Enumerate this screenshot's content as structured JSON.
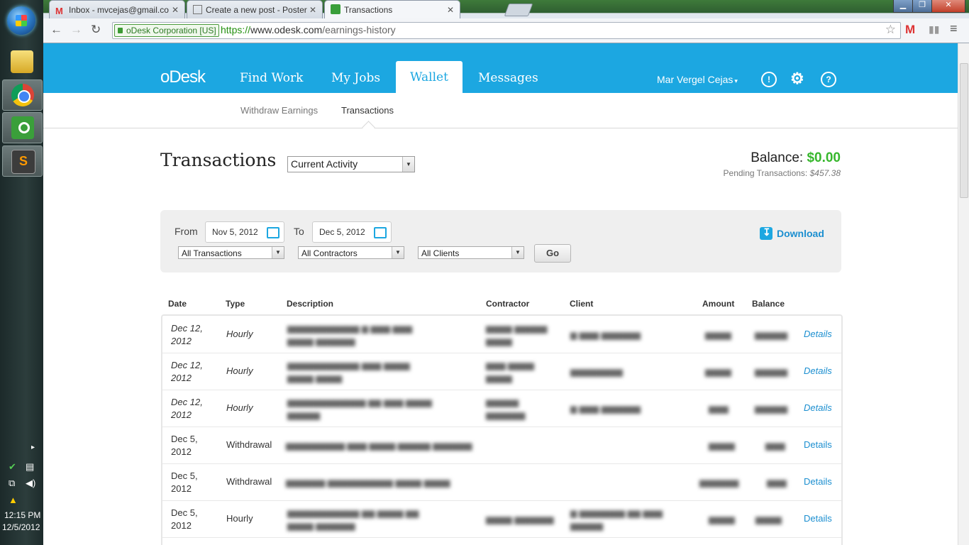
{
  "browser": {
    "tabs": [
      {
        "title": "Inbox - mvcejas@gmail.co",
        "active": false
      },
      {
        "title": "Create a new post - Poster",
        "active": false
      },
      {
        "title": "Transactions",
        "active": true
      }
    ],
    "ev_label": "oDesk Corporation [US]",
    "url_proto": "https://",
    "url_host": "www.odesk.com",
    "url_path": "/earnings-history"
  },
  "taskbar": {
    "time": "12:15 PM",
    "date": "12/5/2012"
  },
  "header": {
    "logo": "oDesk",
    "nav": [
      "Find Work",
      "My Jobs",
      "Wallet",
      "Messages"
    ],
    "active_nav": "Wallet",
    "user_name": "Mar Vergel Cejas"
  },
  "subnav": {
    "items": [
      "Withdraw Earnings",
      "Transactions"
    ],
    "active": "Transactions"
  },
  "page": {
    "title": "Transactions",
    "activity_select": "Current Activity",
    "balance_label": "Balance:",
    "balance_value": "$0.00",
    "pending_label": "Pending Transactions:",
    "pending_value": "$457.38"
  },
  "filters": {
    "from_label": "From",
    "from_date": "Nov 5, 2012",
    "to_label": "To",
    "to_date": "Dec 5, 2012",
    "type_select": "All Transactions",
    "contractor_select": "All Contractors",
    "client_select": "All Clients",
    "go_label": "Go",
    "download_label": "Download"
  },
  "table": {
    "headers": [
      "Date",
      "Type",
      "Description",
      "Contractor",
      "Client",
      "Amount",
      "Balance"
    ],
    "details_label": "Details",
    "rows": [
      {
        "date_line1": "Dec 12,",
        "date_line2": "2012",
        "type": "Hourly",
        "italic": true
      },
      {
        "date_line1": "Dec 12,",
        "date_line2": "2012",
        "type": "Hourly",
        "italic": true
      },
      {
        "date_line1": "Dec 12,",
        "date_line2": "2012",
        "type": "Hourly",
        "italic": true
      },
      {
        "date_line1": "Dec 5,",
        "date_line2": "2012",
        "type": "Withdrawal",
        "italic": false
      },
      {
        "date_line1": "Dec 5,",
        "date_line2": "2012",
        "type": "Withdrawal",
        "italic": false
      },
      {
        "date_line1": "Dec 5,",
        "date_line2": "2012",
        "type": "Hourly",
        "italic": false
      }
    ]
  },
  "colors": {
    "brand_blue": "#1ca7e1",
    "balance_green": "#37b72d",
    "link_blue": "#1c8fd0"
  }
}
